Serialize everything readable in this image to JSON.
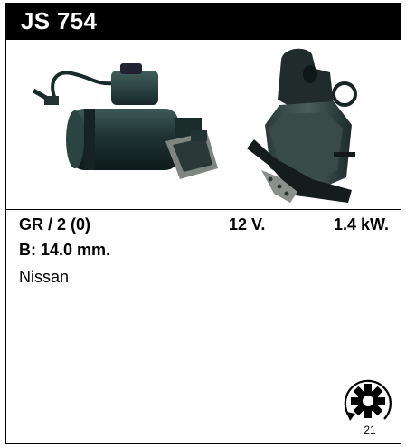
{
  "header": {
    "part_code": "JS 754"
  },
  "photos": {
    "side_view_icon": "starter-motor-side-photo",
    "end_view_icon": "starter-motor-end-photo"
  },
  "specs": {
    "gear": "GR / 2 (0)",
    "voltage": "12 V.",
    "power": "1.4 kW.",
    "bolt": "B: 14.0 mm."
  },
  "make": "Nissan",
  "rotation": {
    "icon": "rotation-gear-icon",
    "label": "21"
  },
  "colors": {
    "header_bg": "#000000",
    "header_text": "#ffffff",
    "border": "#000000"
  }
}
